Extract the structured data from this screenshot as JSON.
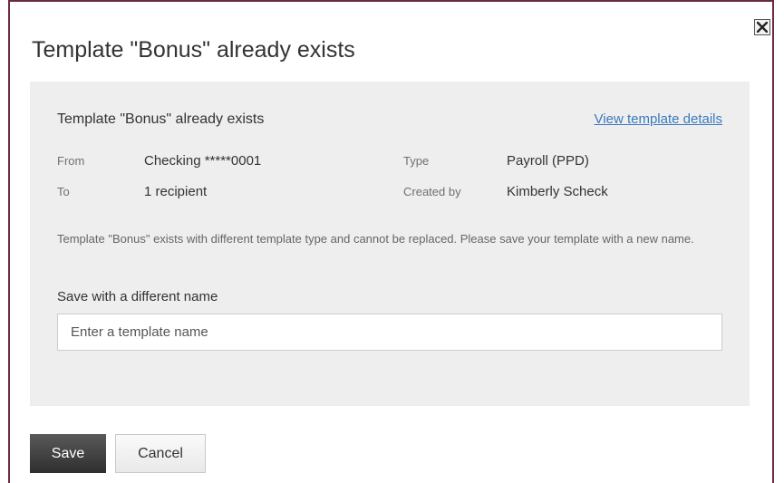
{
  "dialog": {
    "title": "Template \"Bonus\" already exists",
    "close_icon": "close-icon"
  },
  "summary": {
    "title": "Template \"Bonus\" already exists",
    "view_details_link": "View template details",
    "from_label": "From",
    "from_value": "Checking *****0001",
    "to_label": "To",
    "to_value": "1 recipient",
    "type_label": "Type",
    "type_value": "Payroll (PPD)",
    "created_by_label": "Created by",
    "created_by_value": "Kimberly Scheck",
    "notice": "Template \"Bonus\" exists with different template type and cannot be replaced. Please save your template with a new name."
  },
  "form": {
    "name_label": "Save with a different name",
    "name_placeholder": "Enter a template name",
    "name_value": ""
  },
  "actions": {
    "save_label": "Save",
    "cancel_label": "Cancel"
  },
  "colors": {
    "border_accent": "#6b2b3f",
    "link": "#3a7abf",
    "panel_bg": "#eeeeee",
    "save_bg": "#3f3f3f"
  }
}
